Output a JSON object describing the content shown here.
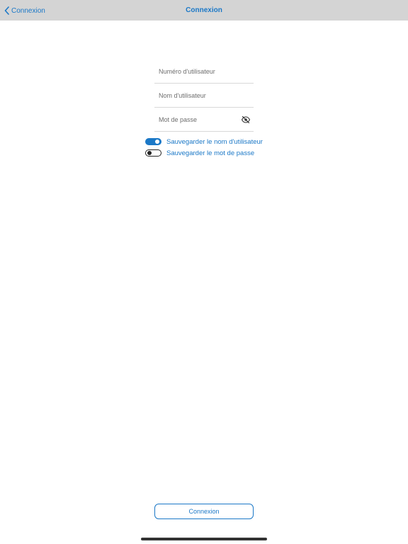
{
  "navbar": {
    "back_label": "Connexion",
    "title": "Connexion"
  },
  "form": {
    "user_number_placeholder": "Numéro d'utilisateur",
    "username_placeholder": "Nom d'utilisateur",
    "password_placeholder": "Mot de passe",
    "password_visibility_icon": "eye-off-icon"
  },
  "toggles": [
    {
      "label": "Sauvegarder le nom d'utilisateur",
      "on": true
    },
    {
      "label": "Sauvegarder le mot de passe",
      "on": false
    }
  ],
  "login_button_label": "Connexion",
  "colors": {
    "accent": "#1b78c7",
    "navbar_bg": "#d4d4d4"
  }
}
